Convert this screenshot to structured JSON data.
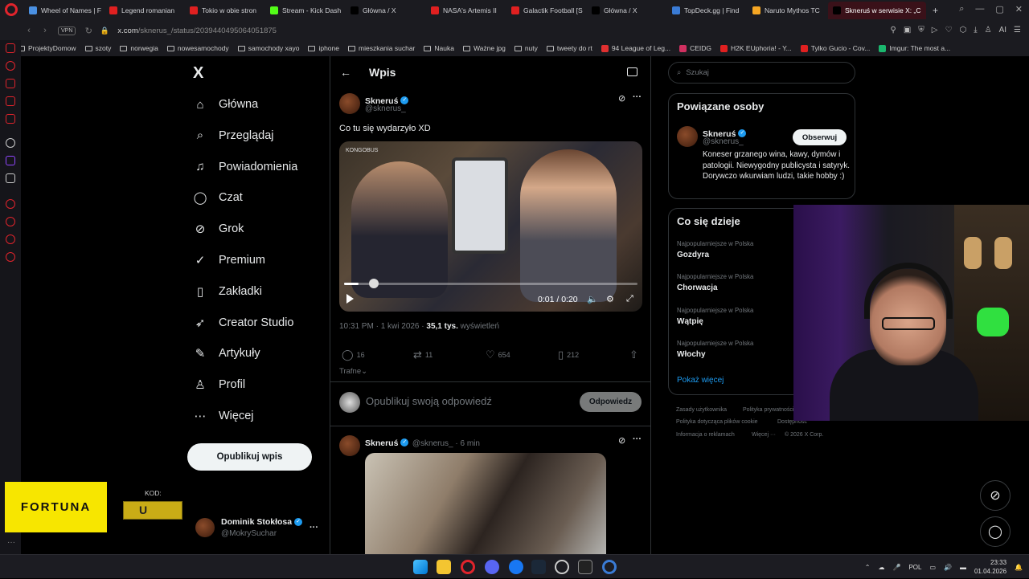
{
  "browser": {
    "tabs": [
      {
        "label": "Wheel of Names | F",
        "color": "#4a90e2"
      },
      {
        "label": "Legend romanian",
        "color": "#e02020"
      },
      {
        "label": "Tokio w obie stron",
        "color": "#e02020"
      },
      {
        "label": "Stream - Kick Dash",
        "color": "#53fc18"
      },
      {
        "label": "Główna / X",
        "color": "#000000"
      },
      {
        "label": "NASA's Artemis II",
        "color": "#e02020"
      },
      {
        "label": "Galactik Football [S",
        "color": "#e02020"
      },
      {
        "label": "Główna / X",
        "color": "#000000"
      },
      {
        "label": "TopDeck.gg | Find",
        "color": "#3a7bd5"
      },
      {
        "label": "Naruto Mythos TC",
        "color": "#f5a623"
      },
      {
        "label": "Skneruś w serwisie X: „C",
        "color": "#000000",
        "active": true
      }
    ],
    "url_domain": "x.com",
    "url_path": "/sknerus_/status/2039440495064051875",
    "vpn_label": "VPN",
    "ai_label": "AI",
    "bookmarks": [
      {
        "label": "ProjektyDomow",
        "icon": "folder"
      },
      {
        "label": "szoty",
        "icon": "folder"
      },
      {
        "label": "norwegia",
        "icon": "folder"
      },
      {
        "label": "nowesamochody",
        "icon": "folder"
      },
      {
        "label": "samochody xayo",
        "icon": "folder"
      },
      {
        "label": "iphone",
        "icon": "folder"
      },
      {
        "label": "mieszkania suchar",
        "icon": "folder"
      },
      {
        "label": "Nauka",
        "icon": "folder"
      },
      {
        "label": "Ważne jpg",
        "icon": "folder"
      },
      {
        "label": "nuty",
        "icon": "folder"
      },
      {
        "label": "tweety do rt",
        "icon": "folder"
      },
      {
        "label": "94 League of Leg...",
        "icon": "site",
        "color": "#e03030"
      },
      {
        "label": "CEIDG",
        "icon": "site",
        "color": "#d03060"
      },
      {
        "label": "H2K EUphoria! - Y...",
        "icon": "site",
        "color": "#e02020"
      },
      {
        "label": "Tylko Gucio - Cov...",
        "icon": "site",
        "color": "#e02020"
      },
      {
        "label": "Imgur: The most a...",
        "icon": "site",
        "color": "#1bb76e"
      }
    ]
  },
  "x": {
    "logo": "X",
    "nav": [
      {
        "label": "Główna",
        "icon": "home-icon",
        "glyph": "⌂"
      },
      {
        "label": "Przeglądaj",
        "icon": "search-icon",
        "glyph": "⌕"
      },
      {
        "label": "Powiadomienia",
        "icon": "bell-icon",
        "glyph": "♫"
      },
      {
        "label": "Czat",
        "icon": "chat-icon",
        "glyph": "◯"
      },
      {
        "label": "Grok",
        "icon": "grok-icon",
        "glyph": "⊘"
      },
      {
        "label": "Premium",
        "icon": "premium-icon",
        "glyph": "✓"
      },
      {
        "label": "Zakładki",
        "icon": "bookmark-icon",
        "glyph": "▯"
      },
      {
        "label": "Creator Studio",
        "icon": "rocket-icon",
        "glyph": "➶"
      },
      {
        "label": "Artykuły",
        "icon": "articles-icon",
        "glyph": "✎"
      },
      {
        "label": "Profil",
        "icon": "profile-icon",
        "glyph": "♙"
      },
      {
        "label": "Więcej",
        "icon": "more-icon",
        "glyph": "⋯"
      }
    ],
    "post_button": "Opublikuj wpis",
    "account": {
      "name": "Dominik Stokłosa",
      "handle": "@MokrySuchar"
    },
    "header": {
      "title": "Wpis",
      "back": "←"
    },
    "post": {
      "author": "Skneruś",
      "handle": "@sknerus_",
      "text": "Co tu się wydarzyło XD",
      "video_time": "0:01 / 0:20",
      "video_progress": 0.05,
      "time": "10:31 PM · 1 kwi 2026 · ",
      "views_number": "35,1 tys.",
      "views_label": " wyświetleń",
      "replies": "16",
      "reposts": "11",
      "likes": "654",
      "bookmarks": "212"
    },
    "sort_label": "Trafne",
    "reply_placeholder": "Opublikuj swoją odpowiedź",
    "reply_button": "Odpowiedz",
    "reply_post": {
      "author": "Skneruś",
      "handle": "@sknerus_ · 6 min"
    },
    "search_placeholder": "Szukaj",
    "related": {
      "title": "Powiązane osoby",
      "name": "Skneruś",
      "handle": "@sknerus_",
      "follow": "Obserwuj",
      "bio": "Koneser grzanego wina, kawy, dymów i patologii. Niewygodny publicysta i satyryk. Dorywczo wkurwiam ludzi, takie hobby :)"
    },
    "trends": {
      "title": "Co się dzieje",
      "items": [
        {
          "context": "Najpopularniejsze w Polska",
          "name": "Gozdyra"
        },
        {
          "context": "Najpopularniejsze w Polska",
          "name": "Chorwacja"
        },
        {
          "context": "Najpopularniejsze w Polska",
          "name": "Wątpię"
        },
        {
          "context": "Najpopularniejsze w Polska",
          "name": "Włochy"
        }
      ],
      "show_more": "Pokaż więcej"
    },
    "footer": {
      "l1": "Zasady użytkownika",
      "l2": "Polityka prywatności",
      "l3": "Polityka dotycząca plików cookie",
      "l4": "Dostępność",
      "l5": "Informacja o reklamach",
      "l6": "Więcej ···",
      "l7": "© 2026 X Corp."
    }
  },
  "overlay": {
    "fortuna": "FORTUNA",
    "kod_label": "KOD:",
    "kod_value": "U",
    "video_overlay": "KONGOBUS"
  },
  "taskbar": {
    "lang": "POL",
    "time": "23:33",
    "date": "01.04.2026"
  }
}
